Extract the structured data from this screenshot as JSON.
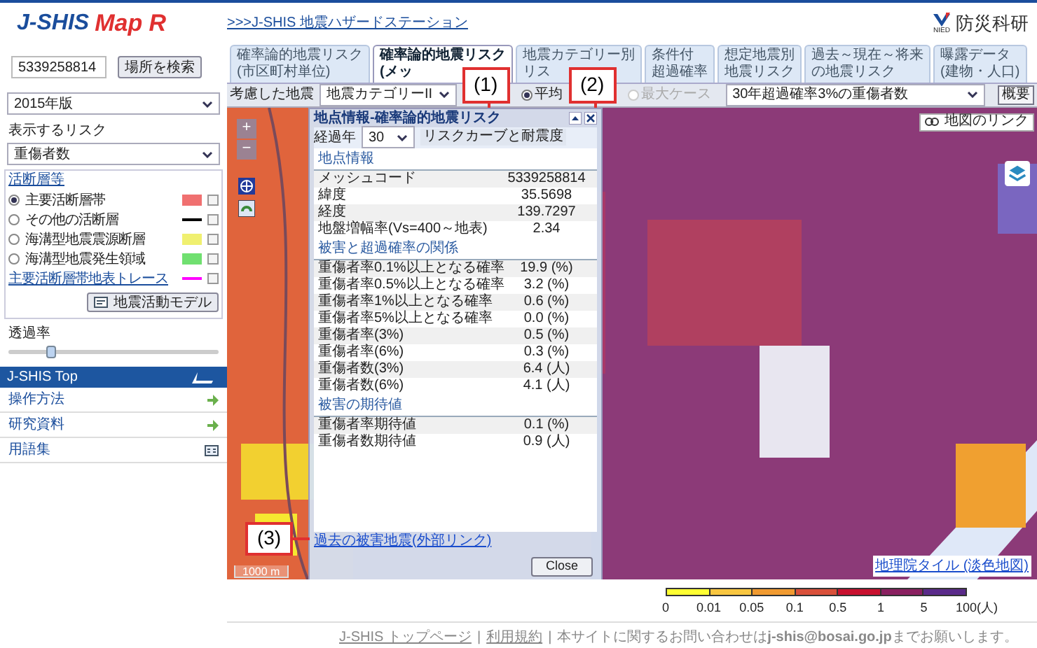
{
  "logo": {
    "text": "J-SHIS",
    "suffix": "Map R"
  },
  "search": {
    "value": "5339258814",
    "button": "場所を検索"
  },
  "version_select": {
    "value": "2015年版"
  },
  "risk": {
    "label": "表示するリスク",
    "value": "重傷者数"
  },
  "faults": {
    "legend": "活断層等",
    "items": [
      {
        "kind": "radio",
        "label": "主要活断層帯",
        "selected": true,
        "swatch": {
          "kind": "box",
          "color": "#f07070"
        },
        "checked": false
      },
      {
        "kind": "radio",
        "label": "その他の活断層",
        "selected": false,
        "swatch": {
          "kind": "line",
          "color": "#000000"
        },
        "checked": false
      },
      {
        "kind": "radio",
        "label": "海溝型地震震源断層",
        "selected": false,
        "swatch": {
          "kind": "box",
          "color": "#f0f070"
        },
        "checked": false
      },
      {
        "kind": "radio",
        "label": "海溝型地震発生領域",
        "selected": false,
        "swatch": {
          "kind": "box",
          "color": "#70e070"
        },
        "checked": false
      },
      {
        "kind": "link",
        "label": "主要活断層帯地表トレース",
        "swatch": {
          "kind": "line",
          "color": "#ff00ff"
        },
        "checked": false
      }
    ]
  },
  "model_button": "地震活動モデル",
  "opacity": {
    "label": "透過率",
    "level": 0.2
  },
  "nav": {
    "title": "J-SHIS Top",
    "items": [
      {
        "label": "操作方法",
        "kind": "arrow"
      },
      {
        "label": "研究資料",
        "kind": "arrow"
      },
      {
        "label": "用語集",
        "kind": "glossary"
      }
    ]
  },
  "header": {
    "link": ">>>J-SHIS 地震ハザードステーション",
    "org": "防災科研",
    "org_sub": "NIED"
  },
  "tabs": [
    {
      "lines": [
        "確率論的地震リスク",
        "(市区町村単位)"
      ],
      "selected": false
    },
    {
      "lines": [
        "確率論的地震リスク",
        "(メッ"
      ],
      "selected": true
    },
    {
      "lines": [
        "地震カテゴリー別",
        "リス"
      ],
      "selected": false
    },
    {
      "lines": [
        "条件付",
        "超過確率"
      ],
      "selected": false
    },
    {
      "lines": [
        "想定地震別",
        "地震リスク"
      ],
      "selected": false
    },
    {
      "lines": [
        "過去～現在～将来",
        "の地震リスク"
      ],
      "selected": false
    },
    {
      "lines": [
        "曝露データ",
        "(建物・人口)"
      ],
      "selected": false
    }
  ],
  "toolbar": {
    "quake_label": "考慮した地震",
    "quake_value": "地震カテゴリーII",
    "cases": [
      {
        "label": "平均",
        "selected": true,
        "disabled": false
      },
      {
        "label": "最大ケース",
        "selected": false,
        "disabled": true
      }
    ],
    "measure": "30年超過確率3%の重傷者数",
    "overview": "概要"
  },
  "map": {
    "zoom_in": "+",
    "zoom_out": "−",
    "link_button": "地図のリンク",
    "scale": "1000 m",
    "attribution": "地理院タイル (淡色地図)"
  },
  "popup": {
    "title": "地点情報-確率論的地震リスク",
    "years_label": "経過年",
    "years": "30",
    "curve_button": "リスクカーブと耐震度",
    "sections": [
      {
        "title": "地点情報",
        "rows": [
          {
            "label": "メッシュコード",
            "value": "5339258814"
          },
          {
            "label": "緯度",
            "value": "35.5698"
          },
          {
            "label": "経度",
            "value": "139.7297"
          },
          {
            "label": "地盤増幅率(Vs=400～地表)",
            "value": "2.34"
          }
        ]
      },
      {
        "title": "被害と超過確率の関係",
        "rows": [
          {
            "label": "重傷者率0.1%以上となる確率",
            "value": "19.9 (%)"
          },
          {
            "label": "重傷者率0.5%以上となる確率",
            "value": "3.2 (%)"
          },
          {
            "label": "重傷者率1%以上となる確率",
            "value": "0.6 (%)"
          },
          {
            "label": "重傷者率5%以上となる確率",
            "value": "0.0 (%)"
          },
          {
            "label": "重傷者率(3%)",
            "value": "0.5 (%)"
          },
          {
            "label": "重傷者率(6%)",
            "value": "0.3 (%)"
          },
          {
            "label": "重傷者数(3%)",
            "value": "6.4 (人)"
          },
          {
            "label": "重傷者数(6%)",
            "value": "4.1 (人)"
          }
        ]
      },
      {
        "title": "被害の期待値",
        "rows": [
          {
            "label": "重傷者率期待値",
            "value": "0.1 (%)"
          },
          {
            "label": "重傷者数期待値",
            "value": "0.9 (人)"
          }
        ]
      }
    ],
    "link": "過去の被害地震(外部リンク)",
    "close": "Close"
  },
  "callouts": [
    {
      "label": "(1)"
    },
    {
      "label": "(2)"
    },
    {
      "label": "(3)"
    }
  ],
  "legend": {
    "segments": [
      {
        "color": "#ffff33"
      },
      {
        "color": "#f8c640"
      },
      {
        "color": "#f09a30"
      },
      {
        "color": "#d9503a"
      },
      {
        "color": "#c8102e"
      },
      {
        "color": "#8a2060"
      },
      {
        "color": "#5a2a8a"
      }
    ],
    "ticks": [
      "0",
      "0.01",
      "0.05",
      "0.1",
      "0.5",
      "1",
      "5",
      "100(人)"
    ]
  },
  "footer": {
    "links": [
      "J-SHIS トップページ",
      "利用規約"
    ],
    "separator": "|",
    "text": "本サイトに関するお問い合わせは**j-shis@bosai.go.jp**までお願いします。"
  }
}
